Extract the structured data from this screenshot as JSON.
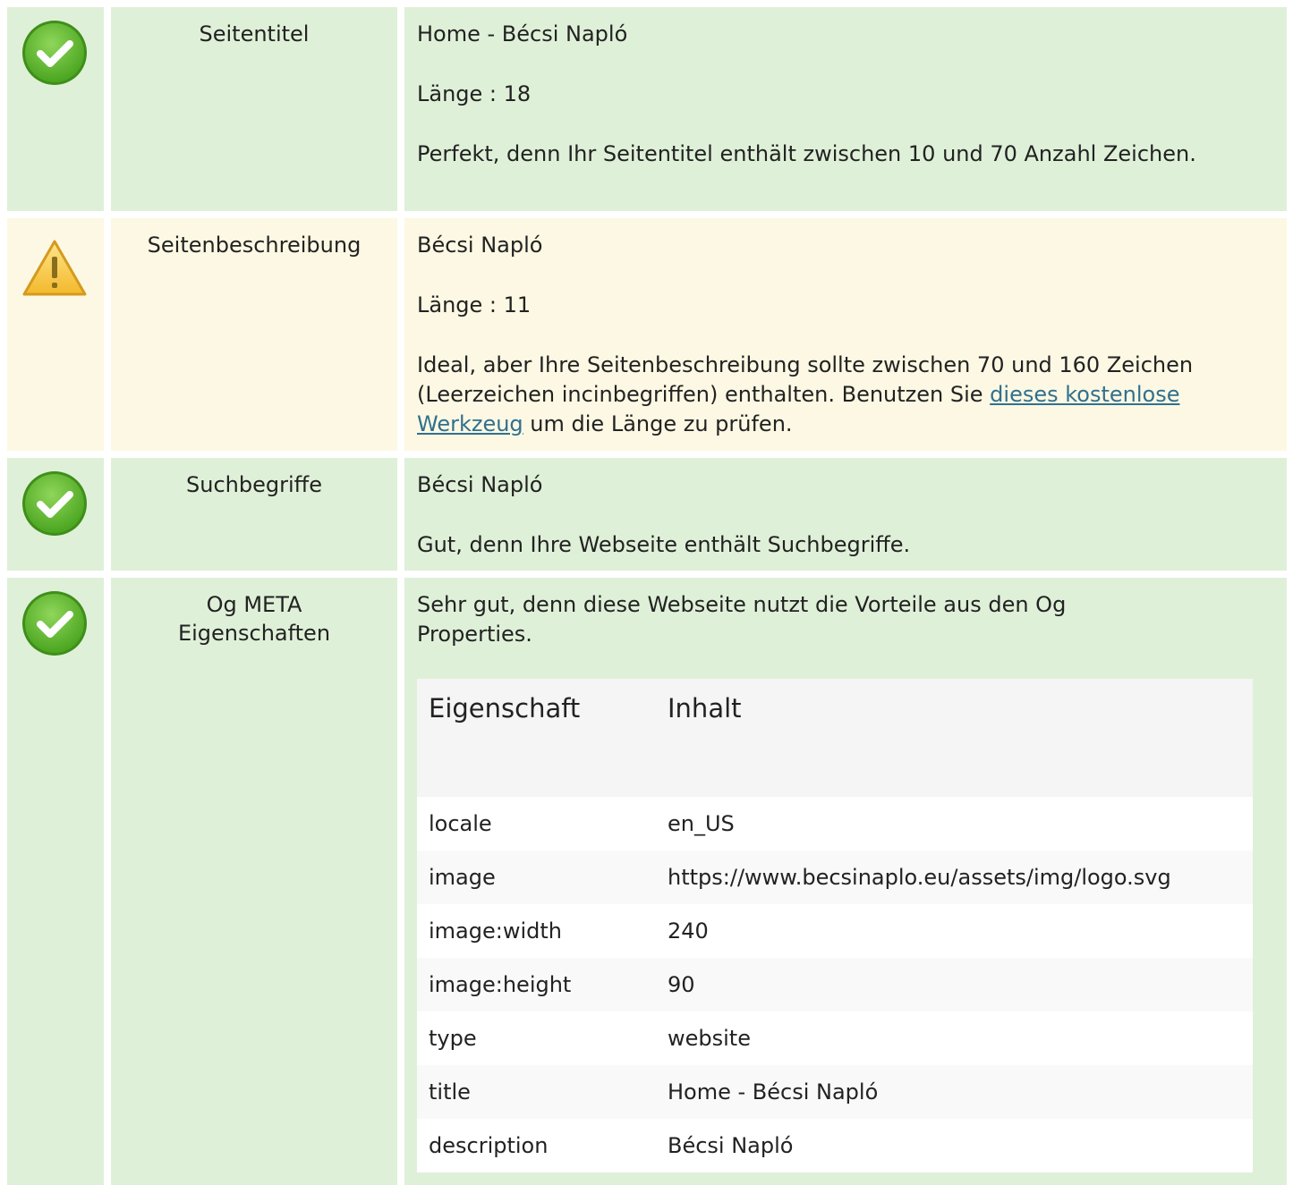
{
  "rows": [
    {
      "status": "good",
      "icon": "check-circle-icon",
      "label": "Seitentitel",
      "value": "Home - Bécsi Napló",
      "length": "Länge : 18",
      "message": "Perfekt, denn Ihr Seitentitel enthält zwischen 10 und 70 Anzahl Zeichen."
    },
    {
      "status": "warning",
      "icon": "warning-triangle-icon",
      "label": "Seitenbeschreibung",
      "value": "Bécsi Napló",
      "length": "Länge : 11",
      "message_before": "Ideal, aber Ihre Seitenbeschreibung sollte zwischen 70 und 160 Zeichen (Leerzeichen incinbegriffen) enthalten. Benutzen Sie ",
      "message_link": "dieses kostenlose Werkzeug",
      "message_after": " um die Länge zu prüfen."
    },
    {
      "status": "good",
      "icon": "check-circle-icon",
      "label": "Suchbegriffe",
      "value": "Bécsi Napló",
      "message": "Gut, denn Ihre Webseite enthält Suchbegriffe."
    },
    {
      "status": "good",
      "icon": "check-circle-icon",
      "label": "Og META Eigenschaften",
      "message": "Sehr gut, denn diese Webseite nutzt die Vorteile aus den Og Properties.",
      "table": {
        "headers": [
          "Eigenschaft",
          "Inhalt"
        ],
        "rows": [
          [
            "locale",
            "en_US"
          ],
          [
            "image",
            "https://www.becsinaplo.eu/assets/img/logo.svg"
          ],
          [
            "image:width",
            "240"
          ],
          [
            "image:height",
            "90"
          ],
          [
            "type",
            "website"
          ],
          [
            "title",
            "Home - Bécsi Napló"
          ],
          [
            "description",
            "Bécsi Napló"
          ]
        ]
      }
    }
  ],
  "colors": {
    "good_bg": "#dff0d8",
    "warning_bg": "#fcf8e3",
    "link": "#31708f",
    "check_green": "#5cb82e",
    "warning_yellow": "#f5c73a"
  }
}
